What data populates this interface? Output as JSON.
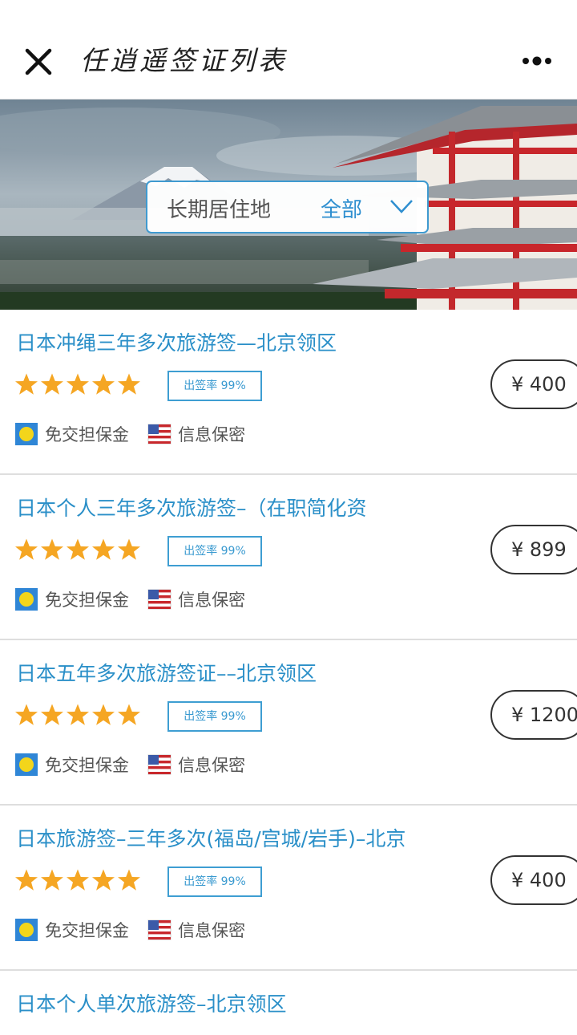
{
  "header": {
    "title": "任逍遥签证列表",
    "close_icon": "close-icon",
    "more_icon": "more-horizontal-icon"
  },
  "filter": {
    "label": "长期居住地",
    "value": "全部",
    "icon": "chevron-down-icon"
  },
  "colors": {
    "accent": "#2a8fc8",
    "star": "#f5a623",
    "border_blue": "#3e9ed2"
  },
  "items": [
    {
      "title": "日本冲绳三年多次旅游签—北京领区",
      "rating": 5,
      "badge": "出签率 99%",
      "features": [
        "免交担保金",
        "信息保密"
      ],
      "price": "¥ 400"
    },
    {
      "title": "日本个人三年多次旅游签–（在职简化资",
      "rating": 5,
      "badge": "出签率 99%",
      "features": [
        "免交担保金",
        "信息保密"
      ],
      "price": "¥ 899"
    },
    {
      "title": "日本五年多次旅游签证––北京领区",
      "rating": 5,
      "badge": "出签率 99%",
      "features": [
        "免交担保金",
        "信息保密"
      ],
      "price": "¥ 1200"
    },
    {
      "title": "日本旅游签–三年多次(福岛/宫城/岩手)–北京",
      "rating": 5,
      "badge": "出签率 99%",
      "features": [
        "免交担保金",
        "信息保密"
      ],
      "price": "¥ 400"
    },
    {
      "title": "日本个人单次旅游签–北京领区"
    }
  ]
}
